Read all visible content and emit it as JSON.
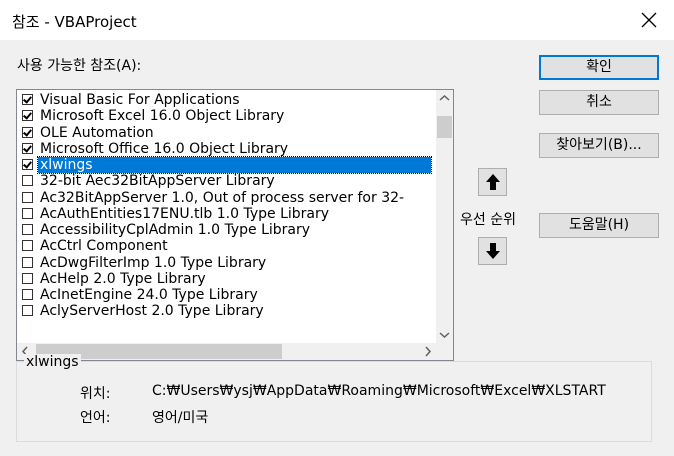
{
  "window": {
    "title": "참조 - VBAProject"
  },
  "available_label": "사용 가능한 참조(A):",
  "references": [
    {
      "label": "Visual Basic For Applications",
      "checked": true,
      "selected": false
    },
    {
      "label": "Microsoft Excel 16.0 Object Library",
      "checked": true,
      "selected": false
    },
    {
      "label": "OLE Automation",
      "checked": true,
      "selected": false
    },
    {
      "label": "Microsoft Office 16.0 Object Library",
      "checked": true,
      "selected": false
    },
    {
      "label": "xlwings",
      "checked": true,
      "selected": true
    },
    {
      "label": "32-bit Aec32BitAppServer Library",
      "checked": false,
      "selected": false
    },
    {
      "label": "Ac32BitAppServer 1.0, Out of process server for 32-",
      "checked": false,
      "selected": false
    },
    {
      "label": "AcAuthEntities17ENU.tlb 1.0 Type Library",
      "checked": false,
      "selected": false
    },
    {
      "label": "AccessibilityCplAdmin 1.0 Type Library",
      "checked": false,
      "selected": false
    },
    {
      "label": "AcCtrl Component",
      "checked": false,
      "selected": false
    },
    {
      "label": "AcDwgFilterImp 1.0 Type Library",
      "checked": false,
      "selected": false
    },
    {
      "label": "AcHelp 2.0 Type Library",
      "checked": false,
      "selected": false
    },
    {
      "label": "AcInetEngine 24.0 Type Library",
      "checked": false,
      "selected": false
    },
    {
      "label": "AclyServerHost 2.0 Type Library",
      "checked": false,
      "selected": false
    }
  ],
  "buttons": {
    "ok": "확인",
    "cancel": "취소",
    "browse": "찾아보기(B)...",
    "help": "도움말(H)"
  },
  "priority_label": "우선 순위",
  "details": {
    "name": "xlwings",
    "location_label": "위치:",
    "location_value": "C:₩Users₩ysj₩AppData₩Roaming₩Microsoft₩Excel₩XLSTART",
    "language_label": "언어:",
    "language_value": "영어/미국"
  },
  "colors": {
    "selection": "#0078d7",
    "default_border": "#0078d7"
  }
}
